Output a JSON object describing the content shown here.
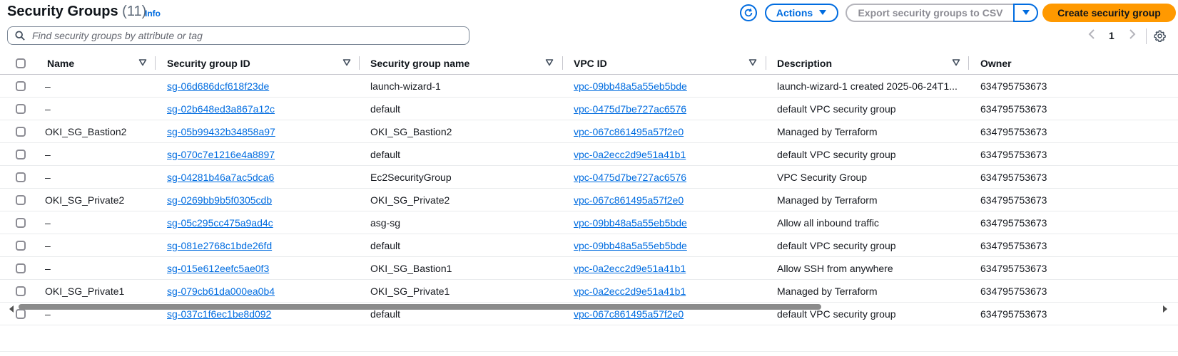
{
  "header": {
    "title": "Security Groups",
    "count": "(11)",
    "info": "Info",
    "actions_label": "Actions",
    "export_label": "Export security groups to CSV",
    "create_label": "Create security group"
  },
  "search": {
    "placeholder": "Find security groups by attribute or tag",
    "value": ""
  },
  "pagination": {
    "current_page": "1"
  },
  "table": {
    "columns": [
      "Name",
      "Security group ID",
      "Security group name",
      "VPC ID",
      "Description",
      "Owner"
    ],
    "rows": [
      {
        "name": "–",
        "sg_id": "sg-06d686dcf618f23de",
        "sg_name": "launch-wizard-1",
        "vpc_id": "vpc-09bb48a5a55eb5bde",
        "description": "launch-wizard-1 created 2025-06-24T1...",
        "owner": "634795753673"
      },
      {
        "name": "–",
        "sg_id": "sg-02b648ed3a867a12c",
        "sg_name": "default",
        "vpc_id": "vpc-0475d7be727ac6576",
        "description": "default VPC security group",
        "owner": "634795753673"
      },
      {
        "name": "OKI_SG_Bastion2",
        "sg_id": "sg-05b99432b34858a97",
        "sg_name": "OKI_SG_Bastion2",
        "vpc_id": "vpc-067c861495a57f2e0",
        "description": "Managed by Terraform",
        "owner": "634795753673"
      },
      {
        "name": "–",
        "sg_id": "sg-070c7e1216e4a8897",
        "sg_name": "default",
        "vpc_id": "vpc-0a2ecc2d9e51a41b1",
        "description": "default VPC security group",
        "owner": "634795753673"
      },
      {
        "name": "–",
        "sg_id": "sg-04281b46a7ac5dca6",
        "sg_name": "Ec2SecurityGroup",
        "vpc_id": "vpc-0475d7be727ac6576",
        "description": "VPC Security Group",
        "owner": "634795753673"
      },
      {
        "name": "OKI_SG_Private2",
        "sg_id": "sg-0269bb9b5f0305cdb",
        "sg_name": "OKI_SG_Private2",
        "vpc_id": "vpc-067c861495a57f2e0",
        "description": "Managed by Terraform",
        "owner": "634795753673"
      },
      {
        "name": "–",
        "sg_id": "sg-05c295cc475a9ad4c",
        "sg_name": "asg-sg",
        "vpc_id": "vpc-09bb48a5a55eb5bde",
        "description": "Allow all inbound traffic",
        "owner": "634795753673"
      },
      {
        "name": "–",
        "sg_id": "sg-081e2768c1bde26fd",
        "sg_name": "default",
        "vpc_id": "vpc-09bb48a5a55eb5bde",
        "description": "default VPC security group",
        "owner": "634795753673"
      },
      {
        "name": "–",
        "sg_id": "sg-015e612eefc5ae0f3",
        "sg_name": "OKI_SG_Bastion1",
        "vpc_id": "vpc-0a2ecc2d9e51a41b1",
        "description": "Allow SSH from anywhere",
        "owner": "634795753673"
      },
      {
        "name": "OKI_SG_Private1",
        "sg_id": "sg-079cb61da000ea0b4",
        "sg_name": "OKI_SG_Private1",
        "vpc_id": "vpc-0a2ecc2d9e51a41b1",
        "description": "Managed by Terraform",
        "owner": "634795753673"
      },
      {
        "name": "–",
        "sg_id": "sg-037c1f6ec1be8d092",
        "sg_name": "default",
        "vpc_id": "vpc-067c861495a57f2e0",
        "description": "default VPC security group",
        "owner": "634795753673"
      }
    ]
  },
  "icons": {
    "refresh": "refresh-icon",
    "search": "search-icon",
    "settings": "gear-icon",
    "sort": "caret-down-icon",
    "actions_caret": "caret-down-icon",
    "pagination_prev": "chevron-left-icon",
    "pagination_next": "chevron-right-icon"
  },
  "colors": {
    "link": "#006ce0",
    "primary_button": "#ff9900",
    "muted_text": "#5f6b7a"
  }
}
